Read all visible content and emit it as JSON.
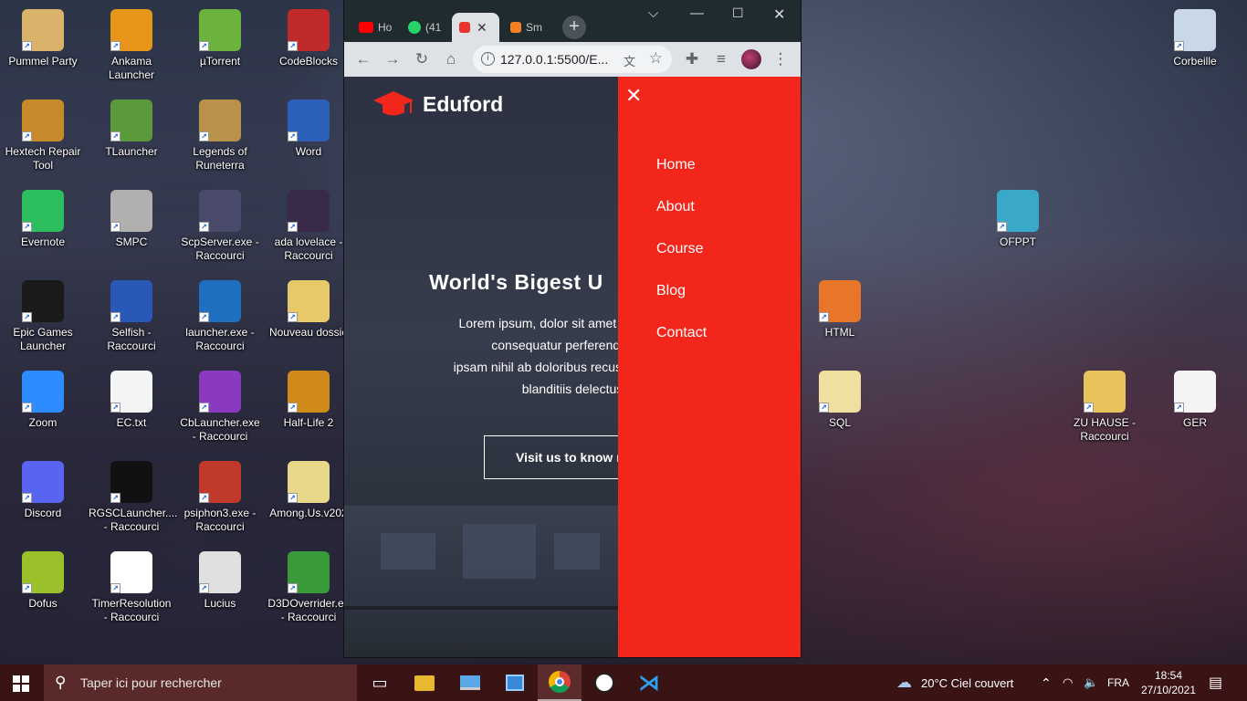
{
  "desktop": {
    "icons": [
      {
        "label": "Pummel Party",
        "icon": "pummel-party-icon",
        "color": "#d9b36a"
      },
      {
        "label": "Ankama Launcher",
        "icon": "ankama-launcher-icon",
        "color": "#e8961a"
      },
      {
        "label": "µTorrent",
        "icon": "utorrent-icon",
        "color": "#6cb33e"
      },
      {
        "label": "CodeBlocks",
        "icon": "codeblocks-icon",
        "color": "#c02a2a"
      },
      {
        "label": "Hextech Repair Tool",
        "icon": "hextech-repair-icon",
        "color": "#c78a2a"
      },
      {
        "label": "TLauncher",
        "icon": "tlauncher-icon",
        "color": "#5a9a3a"
      },
      {
        "label": "Legends of Runeterra",
        "icon": "runeterra-icon",
        "color": "#b8924a"
      },
      {
        "label": "Word",
        "icon": "word-icon",
        "color": "#2b5fb8"
      },
      {
        "label": "Evernote",
        "icon": "evernote-icon",
        "color": "#2dbe60"
      },
      {
        "label": "SMPC",
        "icon": "smpc-icon",
        "color": "#b0b0b0"
      },
      {
        "label": "ScpServer.exe - Raccourci",
        "icon": "scpserver-icon",
        "color": "#4a4a6a"
      },
      {
        "label": "ada lovelace - Raccourci",
        "icon": "ada-lovelace-icon",
        "color": "#3a2a4a"
      },
      {
        "label": "Epic Games Launcher",
        "icon": "epic-games-icon",
        "color": "#1a1a1a"
      },
      {
        "label": "Selfish - Raccourci",
        "icon": "selfish-icon",
        "color": "#2a58b8"
      },
      {
        "label": "launcher.exe - Raccourci",
        "icon": "launcher-exe-icon",
        "color": "#1e6fc0"
      },
      {
        "label": "Nouveau dossie",
        "icon": "folder-icon",
        "color": "#e8c96a"
      },
      {
        "label": "Zoom",
        "icon": "zoom-icon",
        "color": "#2d8cff"
      },
      {
        "label": "EC.txt",
        "icon": "text-file-icon",
        "color": "#f4f4f4"
      },
      {
        "label": "CbLauncher.exe - Raccourci",
        "icon": "cblauncher-icon",
        "color": "#8a3ac0"
      },
      {
        "label": "Half-Life 2",
        "icon": "half-life-icon",
        "color": "#d08a1a"
      },
      {
        "label": "Discord",
        "icon": "discord-icon",
        "color": "#5865f2"
      },
      {
        "label": "RGSCLauncher.... - Raccourci",
        "icon": "rockstar-icon",
        "color": "#111111"
      },
      {
        "label": "psiphon3.exe - Raccourci",
        "icon": "psiphon-icon",
        "color": "#c0392b"
      },
      {
        "label": "Among.Us.v202",
        "icon": "folder-icon",
        "color": "#e8d98a"
      },
      {
        "label": "Dofus",
        "icon": "dofus-icon",
        "color": "#9ac02a"
      },
      {
        "label": "TimerResolution - Raccourci",
        "icon": "timer-icon",
        "color": "#ffffff"
      },
      {
        "label": "Lucius",
        "icon": "lucius-icon",
        "color": "#e0e0e0"
      },
      {
        "label": "D3DOverrider.ex - Raccourci",
        "icon": "d3doverrider-icon",
        "color": "#3a9a3a"
      },
      {
        "label": "Corbeille",
        "icon": "recycle-bin-icon",
        "color": "#c8d8e8"
      },
      {
        "label": "OFPPT",
        "icon": "ofppt-icon",
        "color": "#3aa8c8"
      },
      {
        "label": "HTML",
        "icon": "html-file-icon",
        "color": "#e8762a"
      },
      {
        "label": "SQL",
        "icon": "folder-icon",
        "color": "#f0e0a0"
      },
      {
        "label": "ZU HAUSE - Raccourci",
        "icon": "folder-icon",
        "color": "#e8c25a"
      },
      {
        "label": "GER",
        "icon": "pdf-icon",
        "color": "#f4f4f4"
      }
    ]
  },
  "browser": {
    "tabs": [
      {
        "label": "Ho",
        "icon": "youtube-icon",
        "color": "#ff0000"
      },
      {
        "label": "(41",
        "icon": "whatsapp-icon",
        "color": "#25d366"
      },
      {
        "label": "",
        "icon": "site-icon",
        "color": "#e8322a",
        "close": "✕"
      },
      {
        "label": "Sm",
        "icon": "stackoverflow-icon",
        "color": "#f48024"
      }
    ],
    "new_tab": "+",
    "url": "127.0.0.1:5500/E...",
    "page": {
      "brand": "Eduford",
      "hero_title": "World's Bigest U",
      "hero_lines": [
        "Lorem ipsum, dolor sit amet consectetur",
        "consequatur perferendis, fac",
        "ipsam nihil ab doloribus recusandae cupid",
        "blanditiis delectus"
      ],
      "cta": "Visit us to know mo",
      "menu_close": "✕",
      "menu": [
        "Home",
        "About",
        "Course",
        "Blog",
        "Contact"
      ],
      "accent": "#f2261a"
    }
  },
  "taskbar": {
    "search_placeholder": "Taper ici pour rechercher",
    "weather": "20°C  Ciel couvert",
    "language": "FRA",
    "time": "18:54",
    "date": "27/10/2021"
  }
}
